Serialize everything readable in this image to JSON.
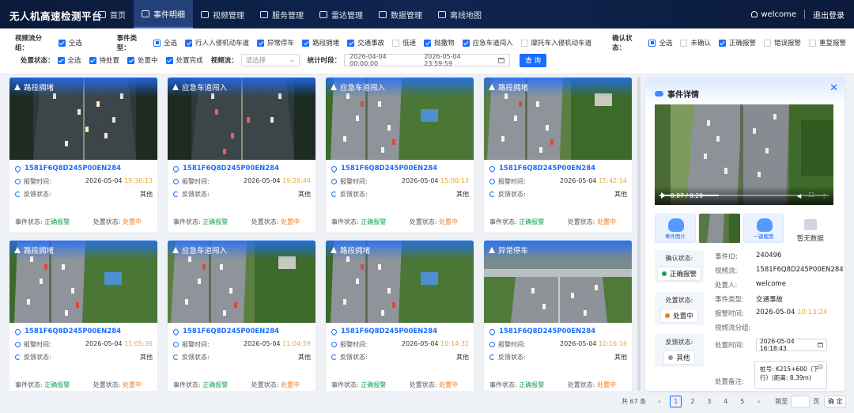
{
  "app": {
    "title": "无人机高速检测平台",
    "nav": [
      {
        "label": "首页",
        "icon": "home-icon",
        "active": false
      },
      {
        "label": "事件明细",
        "icon": "list-icon",
        "active": true
      },
      {
        "label": "视频管理",
        "icon": "video-icon",
        "active": false
      },
      {
        "label": "服务管理",
        "icon": "gear-icon",
        "active": false
      },
      {
        "label": "雷达管理",
        "icon": "radar-icon",
        "active": false
      },
      {
        "label": "数据管理",
        "icon": "data-icon",
        "active": false
      },
      {
        "label": "离线地图",
        "icon": "map-icon",
        "active": false
      }
    ],
    "user": "welcome",
    "logout": "退出登录"
  },
  "filters": {
    "stream_group_label": "视频流分组：",
    "stream_group_all": "全选",
    "event_type_label": "事件类型：",
    "event_types": [
      {
        "label": "全选",
        "state": "half"
      },
      {
        "label": "行人入侵机动车道",
        "state": "on"
      },
      {
        "label": "异常停车",
        "state": "on"
      },
      {
        "label": "路段拥堵",
        "state": "on"
      },
      {
        "label": "交通事故",
        "state": "on"
      },
      {
        "label": "低速",
        "state": "off"
      },
      {
        "label": "抛撒物",
        "state": "on"
      },
      {
        "label": "应急车道闯入",
        "state": "on"
      },
      {
        "label": "摩托车入侵机动车道",
        "state": "off"
      }
    ],
    "confirm_label": "确认状态：",
    "confirm_states": [
      {
        "label": "全选",
        "state": "half"
      },
      {
        "label": "未确认",
        "state": "off"
      },
      {
        "label": "正确报警",
        "state": "on"
      },
      {
        "label": "错误报警",
        "state": "off"
      },
      {
        "label": "重复报警",
        "state": "off"
      }
    ],
    "handle_label": "处置状态：",
    "handle_states": [
      {
        "label": "全选",
        "state": "on"
      },
      {
        "label": "待处置",
        "state": "on"
      },
      {
        "label": "处置中",
        "state": "on"
      },
      {
        "label": "处置完成",
        "state": "on"
      }
    ],
    "video_stream_label": "视频流：",
    "video_stream_placeholder": "请选择",
    "stat_period_label": "统计时段：",
    "start_time": "2026-04-04 00:00:00",
    "end_time": "2026-05-04 23:59:59",
    "query": "查 询"
  },
  "cards": [
    {
      "tag": "路段拥堵",
      "id": "1581F6Q8D245P00EN284",
      "date": "2026-05-04",
      "time": "19:36:13",
      "scene": "night"
    },
    {
      "tag": "应急车道闯入",
      "id": "1581F6Q8D245P00EN284",
      "date": "2026-05-04",
      "time": "19:26:44",
      "scene": "night2"
    },
    {
      "tag": "应急车道闯入",
      "id": "1581F6Q8D245P00EN284",
      "date": "2026-05-04",
      "time": "15:00:13",
      "scene": "day"
    },
    {
      "tag": "路段拥堵",
      "id": "1581F6Q8D245P00EN284",
      "date": "2026-05-04",
      "time": "15:42:14",
      "scene": "day2"
    },
    {
      "tag": "路段拥堵",
      "id": "1581F6Q8D245P00EN284",
      "date": "2026-05-04",
      "time": "11:05:36",
      "scene": "day"
    },
    {
      "tag": "应急车道闯入",
      "id": "1581F6Q8D245P00EN284",
      "date": "2026-05-04",
      "time": "11:04:59",
      "scene": "day2"
    },
    {
      "tag": "路段拥堵",
      "id": "1581F6Q8D245P00EN284",
      "date": "2026-05-04",
      "time": "10:14:32",
      "scene": "day"
    },
    {
      "tag": "异常停车",
      "id": "1581F6Q8D245P00EN284",
      "date": "2026-05-04",
      "time": "10:16:16",
      "scene": "bridge"
    }
  ],
  "card_labels": {
    "report_time": "报警时间:",
    "feedback": "反馈状态:",
    "feedback_value": "其他",
    "event_status": "事件状态:",
    "event_status_value": "正确报警",
    "handle_status": "处置状态:",
    "handle_status_value": "处置中"
  },
  "detail": {
    "title": "事件详情",
    "video_time": "0:07 / 0:20",
    "media_btn1": "事件图片",
    "media_btn2": "一键截图",
    "no_data": "暂无数据",
    "confirm_label": "确认状态:",
    "confirm_value": "正确报警",
    "handle_label": "处置状态:",
    "handle_value": "处置中",
    "feedback_label": "反馈状态:",
    "feedback_value": "其他",
    "fields": {
      "event_id_k": "事件ID:",
      "event_id_v": "240496",
      "stream_k": "视频流:",
      "stream_v": "1581F6Q8D245P00EN284",
      "handler_k": "处置人:",
      "handler_v": "welcome",
      "type_k": "事件类型:",
      "type_v": "交通事故",
      "time_k": "报警时间:",
      "time_date": "2026-05-04",
      "time_clock": "10:13:24",
      "group_k": "视频流分组:",
      "handle_time_k": "处置时间:",
      "handle_time_v": "2026-05-04 16:18:43",
      "note_k": "处置备注:",
      "note_v": "桩号: K215+600（下行）(距离: 8.39m)"
    },
    "colors": {
      "ok": "#18a058",
      "doing": "#f07b1d",
      "other": "#999999"
    }
  },
  "pagination": {
    "total": "共 67 条",
    "pages": [
      "1",
      "2",
      "3",
      "4",
      "5"
    ],
    "current": "1",
    "goto": "跳至",
    "page_unit": "页",
    "confirm": "确 定"
  }
}
